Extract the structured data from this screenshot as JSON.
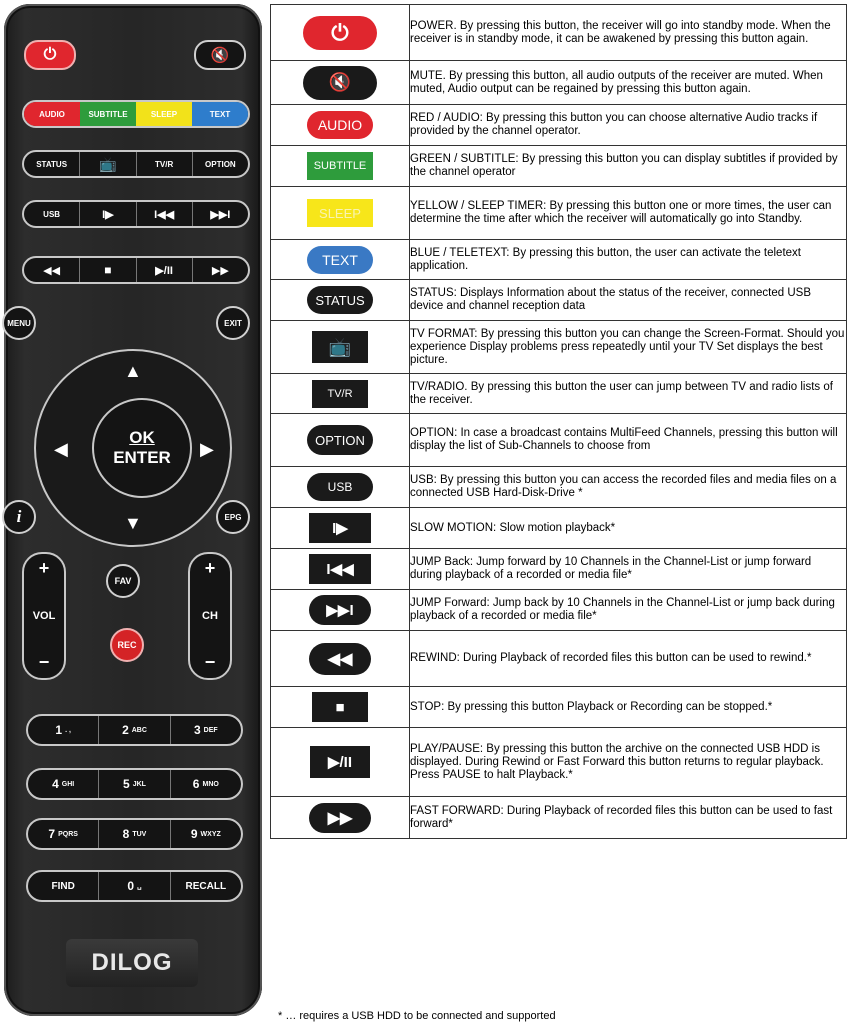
{
  "remote": {
    "power_icon": "power-icon",
    "mute_icon": "mute-icon",
    "color_keys": [
      {
        "label": "AUDIO",
        "color": "#e0262e"
      },
      {
        "label": "SUBTITLE",
        "color": "#2e9c3c"
      },
      {
        "label": "SLEEP",
        "color": "#f2e21a"
      },
      {
        "label": "TEXT",
        "color": "#2e7dcc"
      }
    ],
    "row_status": {
      "status": "STATUS",
      "tvr": "TV/R",
      "option": "OPTION"
    },
    "row_usb": {
      "usb": "USB"
    },
    "menu": "MENU",
    "exit": "EXIT",
    "ok": "OK",
    "enter": "ENTER",
    "epg": "EPG",
    "info": "i",
    "vol": "VOL",
    "ch": "CH",
    "fav": "FAV",
    "rec": "REC",
    "plus": "+",
    "minus": "−",
    "numbers": [
      [
        {
          "n": "1",
          "s": ". ,"
        },
        {
          "n": "2",
          "s": "ABC"
        },
        {
          "n": "3",
          "s": "DEF"
        }
      ],
      [
        {
          "n": "4",
          "s": "GHI"
        },
        {
          "n": "5",
          "s": "JKL"
        },
        {
          "n": "6",
          "s": "MNO"
        }
      ],
      [
        {
          "n": "7",
          "s": "PQRS"
        },
        {
          "n": "8",
          "s": "TUV"
        },
        {
          "n": "9",
          "s": "WXYZ"
        }
      ]
    ],
    "bottom_row": {
      "find": "FIND",
      "zero": "0",
      "recall": "RECALL"
    },
    "brand": "DILOG"
  },
  "rows": [
    {
      "icon": "POWER",
      "glyph": "⏻",
      "bg": "#e0262e",
      "desc": "POWER. By pressing this button, the receiver will go into standby mode. When the receiver is in standby mode, it can be awakened by pressing this button again."
    },
    {
      "icon": "MUTE",
      "glyph": "🔇",
      "bg": "#1a1a1a",
      "desc": "MUTE. By pressing this button, all audio outputs of the receiver are muted. When muted, Audio output can be regained by pressing this button again."
    },
    {
      "icon": "AUDIO",
      "glyph": "AUDIO",
      "bg": "#e0262e",
      "desc": "RED / AUDIO: By pressing this button you can choose alternative Audio tracks if provided by the channel operator."
    },
    {
      "icon": "SUBTITLE",
      "glyph": "SUBTITLE",
      "bg": "#2e9c3c",
      "desc": "GREEN / SUBTITLE: By pressing this button you can display subtitles if provided by the channel operator"
    },
    {
      "icon": "SLEEP",
      "glyph": "SLEEP",
      "bg": "#f7e61a",
      "desc": "YELLOW / SLEEP TIMER: By pressing this button one or more times, the user can determine the time after which the receiver will automatically go into Standby."
    },
    {
      "icon": "TEXT",
      "glyph": "TEXT",
      "bg": "#3a79c4",
      "desc": "BLUE / TELETEXT: By pressing this button, the user can activate the teletext application."
    },
    {
      "icon": "STATUS",
      "glyph": "STATUS",
      "bg": "#1a1a1a",
      "desc": "STATUS: Displays Information about the status of the receiver, connected USB device and channel reception data"
    },
    {
      "icon": "TV FORMAT",
      "glyph": "📺",
      "bg": "#1a1a1a",
      "desc": "TV FORMAT: By pressing this button you can change the Screen-Format. Should you experience Display problems press repeatedly until your TV Set displays the best picture."
    },
    {
      "icon": "TV/R",
      "glyph": "TV/R",
      "bg": "#1a1a1a",
      "desc": "TV/RADIO. By pressing this button the user can jump between TV and radio lists of the receiver."
    },
    {
      "icon": "OPTION",
      "glyph": "OPTION",
      "bg": "#1a1a1a",
      "desc": "OPTION: In case a broadcast contains MultiFeed Channels, pressing this button will display the list of Sub-Channels to choose from"
    },
    {
      "icon": "USB",
      "glyph": "USB",
      "bg": "#1a1a1a",
      "desc": "USB: By pressing this button you can access the recorded files and media files on a connected USB Hard-Disk-Drive *"
    },
    {
      "icon": "SLOW",
      "glyph": "I▶",
      "bg": "#1a1a1a",
      "desc": "SLOW MOTION: Slow motion playback*"
    },
    {
      "icon": "JUMP BACK",
      "glyph": "I◀◀",
      "bg": "#1a1a1a",
      "desc": "JUMP Back: Jump forward by 10 Channels in the Channel-List or jump forward during playback of a recorded or media file*"
    },
    {
      "icon": "JUMP FORWARD",
      "glyph": "▶▶I",
      "bg": "#1a1a1a",
      "desc": "JUMP Forward: Jump back by 10 Channels in the Channel-List or jump back during playback of a recorded or media file*"
    },
    {
      "icon": "REWIND",
      "glyph": "◀◀",
      "bg": "#1a1a1a",
      "desc": "REWIND: During Playback of recorded files this button can be used to rewind.*"
    },
    {
      "icon": "STOP",
      "glyph": "■",
      "bg": "#1a1a1a",
      "desc": "STOP: By pressing this button Playback or Recording can be stopped.*"
    },
    {
      "icon": "PLAY/PAUSE",
      "glyph": "▶/II",
      "bg": "#1a1a1a",
      "desc": "PLAY/PAUSE: By pressing this button the archive on the connected USB HDD is displayed. During Rewind or Fast Forward this button returns to regular playback. Press PAUSE to halt Playback.*"
    },
    {
      "icon": "FAST FORWARD",
      "glyph": "▶▶",
      "bg": "#1a1a1a",
      "desc": "FAST FORWARD: During Playback of recorded files this button can be used to fast forward*"
    }
  ],
  "footnote": "* … requires a USB HDD to be connected and supported"
}
